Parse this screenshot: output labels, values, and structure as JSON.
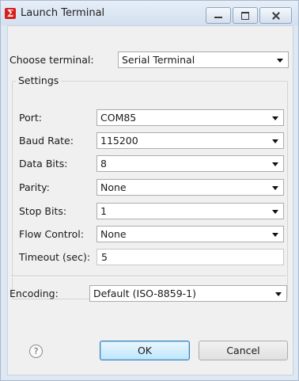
{
  "window": {
    "title": "Launch Terminal",
    "app_icon_glyph": "Σ",
    "app_icon_color": "#d81e1e"
  },
  "terminal": {
    "label": "Choose terminal:",
    "value": "Serial Terminal"
  },
  "settings": {
    "group_title": "Settings",
    "port": {
      "label": "Port:",
      "value": "COM85"
    },
    "baud_rate": {
      "label": "Baud Rate:",
      "value": "115200"
    },
    "data_bits": {
      "label": "Data Bits:",
      "value": "8"
    },
    "parity": {
      "label": "Parity:",
      "value": "None"
    },
    "stop_bits": {
      "label": "Stop Bits:",
      "value": "1"
    },
    "flow_control": {
      "label": "Flow Control:",
      "value": "None"
    },
    "timeout": {
      "label": "Timeout (sec):",
      "value": "5"
    }
  },
  "encoding": {
    "label": "Encoding:",
    "value": "Default (ISO-8859-1)"
  },
  "buttons": {
    "help_glyph": "?",
    "ok_label": "OK",
    "cancel_label": "Cancel"
  },
  "icons": {
    "title_bar": [
      "app-icon",
      "minimize-icon",
      "maximize-icon",
      "close-icon"
    ],
    "combo": "chevron-down-icon",
    "help": "help-icon"
  }
}
